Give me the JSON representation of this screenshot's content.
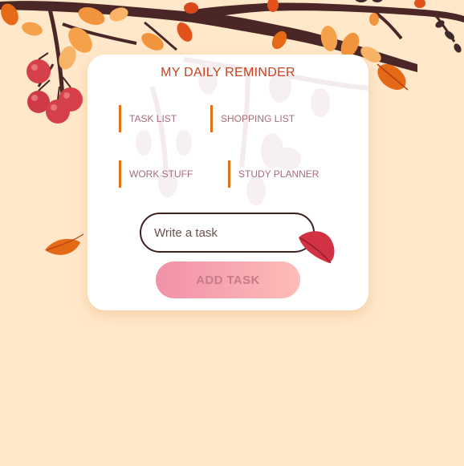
{
  "app": {
    "title": "MY DAILY REMINDER"
  },
  "categories": [
    {
      "label": "TASK LIST"
    },
    {
      "label": "SHOPPING LIST"
    },
    {
      "label": "WORK STUFF"
    },
    {
      "label": "STUDY PLANNER"
    }
  ],
  "task_form": {
    "placeholder": "Write a task",
    "value": "",
    "add_label": "ADD TASK"
  },
  "icons": {
    "branch": "autumn-branch-icon",
    "berries": "berries-icon",
    "leaves": "leaf-icon"
  },
  "colors": {
    "background": "#ffe7c9",
    "card": "#ffffff",
    "title": "#c8431b",
    "category_accent": "#e07218",
    "category_text": "#a36d78",
    "button_gradient_start": "#f191a9",
    "button_gradient_end": "#ffbcb8"
  }
}
